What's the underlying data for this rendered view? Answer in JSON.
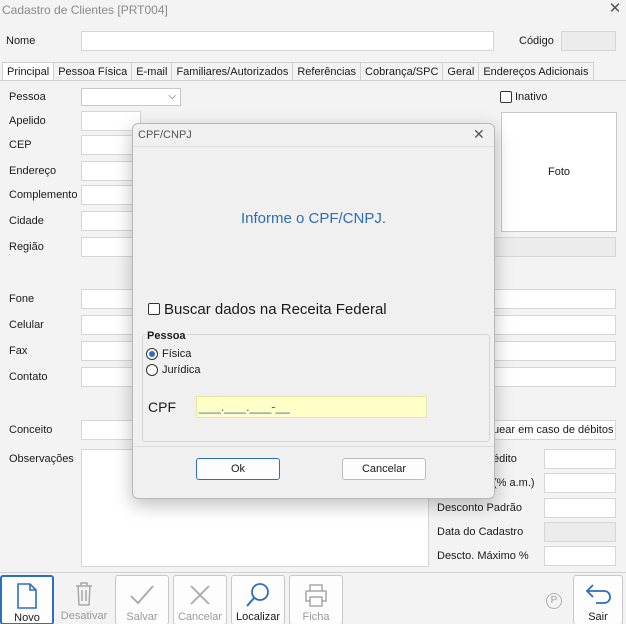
{
  "window": {
    "title": "Cadastro de Clientes [PRT004]"
  },
  "header": {
    "nome_label": "Nome",
    "codigo_label": "Código"
  },
  "tabs": [
    {
      "label": "Principal"
    },
    {
      "label": "Pessoa Física"
    },
    {
      "label": "E-mail"
    },
    {
      "label": "Familiares/Autorizados"
    },
    {
      "label": "Referências"
    },
    {
      "label": "Cobrança/SPC"
    },
    {
      "label": "Geral"
    },
    {
      "label": "Endereços Adicionais"
    }
  ],
  "form": {
    "pessoa": "Pessoa",
    "inativo": "Inativo",
    "apelido": "Apelido",
    "cep": "CEP",
    "endereco": "Endereço",
    "complemento": "Complemento",
    "cidade": "Cidade",
    "regiao": "Região",
    "fone": "Fone",
    "celular": "Celular",
    "fax": "Fax",
    "contato": "Contato",
    "conceito": "Conceito",
    "observacoes": "Observações",
    "foto": "Foto",
    "bloquear": "uear em caso de débitos",
    "credito": "édito",
    "juros": "(% a.m.)",
    "desconto_padrao": "Desconto Padrão",
    "data_cadastro": "Data do Cadastro",
    "descto_maximo": "Descto. Máximo %"
  },
  "toolbar": {
    "novo": "Novo",
    "desativar": "Desativar",
    "salvar": "Salvar",
    "cancelar": "Cancelar",
    "localizar": "Localizar",
    "ficha": "Ficha",
    "sair": "Sair"
  },
  "dialog": {
    "title": "CPF/CNPJ",
    "message": "Informe o CPF/CNPJ.",
    "buscar_receita": "Buscar dados na Receita Federal",
    "pessoa_group": "Pessoa",
    "fisica": "Física",
    "juridica": "Jurídica",
    "cpf_label": "CPF",
    "cpf_value": "___.___.___-__",
    "ok": "Ok",
    "cancelar": "Cancelar"
  }
}
